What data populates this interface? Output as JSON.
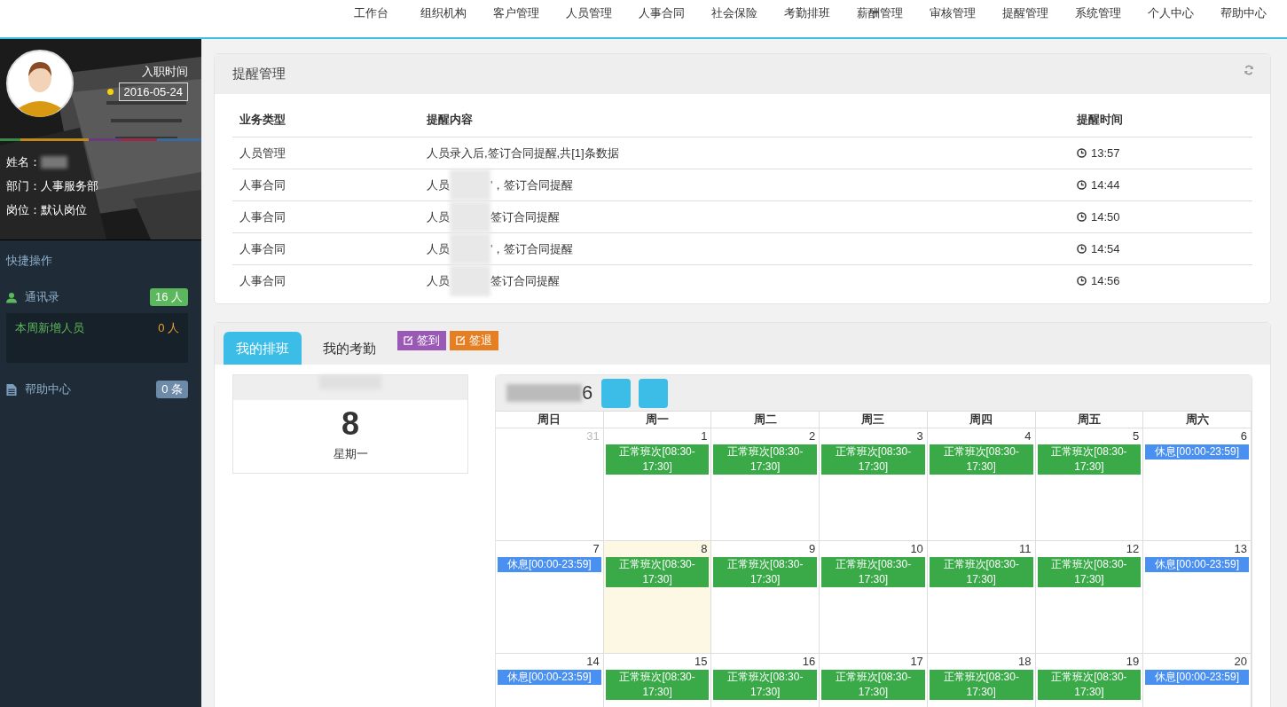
{
  "nav": [
    "工作台",
    "组织机构",
    "客户管理",
    "人员管理",
    "人事合同",
    "社会保险",
    "考勤排班",
    "薪酬管理",
    "审核管理",
    "提醒管理",
    "系统管理",
    "个人中心",
    "帮助中心"
  ],
  "profile": {
    "hire_label": "入职时间",
    "hire_date": "2016-05-24",
    "fields": [
      {
        "label": "姓名：",
        "value_redacted": true
      },
      {
        "label": "部门：人事服务部",
        "value_redacted": false
      },
      {
        "label": "岗位：默认岗位",
        "value_redacted": false
      }
    ]
  },
  "quick": {
    "title": "快捷操作",
    "contacts": {
      "label": "通讯录",
      "count": "16 人"
    },
    "new_staff": {
      "label": "本周新增人员",
      "count": "0 人"
    },
    "help": {
      "label": "帮助中心",
      "count": "0 条"
    }
  },
  "reminders": {
    "title": "提醒管理",
    "columns": [
      "业务类型",
      "提醒内容",
      "提醒时间"
    ],
    "rows": [
      {
        "type": "人员管理",
        "content_start": "人员录入后,签订合同提醒,共[1]条数据",
        "redacted": false,
        "content_end": "",
        "time": "13:57"
      },
      {
        "type": "人事合同",
        "content_start": "人员",
        "redacted": true,
        "content_end": "'，签订合同提醒",
        "time": "14:44"
      },
      {
        "type": "人事合同",
        "content_start": "人员",
        "redacted": true,
        "content_end": "签订合同提醒",
        "time": "14:50"
      },
      {
        "type": "人事合同",
        "content_start": "人员",
        "redacted": true,
        "content_end": "'，签订合同提醒",
        "time": "14:54"
      },
      {
        "type": "人事合同",
        "content_start": "人员",
        "redacted": true,
        "content_end": "签订合同提醒",
        "time": "14:56"
      }
    ]
  },
  "schedule": {
    "tabs": [
      {
        "label": "我的排班",
        "selected": true
      },
      {
        "label": "我的考勤",
        "selected": false
      }
    ],
    "actions": [
      {
        "label": "签到",
        "color": "#9b59b6"
      },
      {
        "label": "签退",
        "color": "#e67e22"
      }
    ],
    "today": {
      "day": "8",
      "weekday": "星期一"
    },
    "calendar": {
      "title_tail": "6",
      "weekdays": [
        "周日",
        "周一",
        "周二",
        "周三",
        "周四",
        "周五",
        "周六"
      ],
      "weeks": [
        [
          {
            "day": "31",
            "other_month": true,
            "today": false
          },
          {
            "day": "1",
            "other_month": false,
            "today": false,
            "event": {
              "kind": "work",
              "label": "正常班次[08:30-17:30]"
            }
          },
          {
            "day": "2",
            "other_month": false,
            "today": false,
            "event": {
              "kind": "work",
              "label": "正常班次[08:30-17:30]"
            }
          },
          {
            "day": "3",
            "other_month": false,
            "today": false,
            "event": {
              "kind": "work",
              "label": "正常班次[08:30-17:30]"
            }
          },
          {
            "day": "4",
            "other_month": false,
            "today": false,
            "event": {
              "kind": "work",
              "label": "正常班次[08:30-17:30]"
            }
          },
          {
            "day": "5",
            "other_month": false,
            "today": false,
            "event": {
              "kind": "work",
              "label": "正常班次[08:30-17:30]"
            }
          },
          {
            "day": "6",
            "other_month": false,
            "today": false,
            "event": {
              "kind": "rest",
              "label": "休息[00:00-23:59]"
            }
          }
        ],
        [
          {
            "day": "7",
            "other_month": false,
            "today": false,
            "event": {
              "kind": "rest",
              "label": "休息[00:00-23:59]"
            }
          },
          {
            "day": "8",
            "other_month": false,
            "today": true,
            "event": {
              "kind": "work",
              "label": "正常班次[08:30-17:30]"
            }
          },
          {
            "day": "9",
            "other_month": false,
            "today": false,
            "event": {
              "kind": "work",
              "label": "正常班次[08:30-17:30]"
            }
          },
          {
            "day": "10",
            "other_month": false,
            "today": false,
            "event": {
              "kind": "work",
              "label": "正常班次[08:30-17:30]"
            }
          },
          {
            "day": "11",
            "other_month": false,
            "today": false,
            "event": {
              "kind": "work",
              "label": "正常班次[08:30-17:30]"
            }
          },
          {
            "day": "12",
            "other_month": false,
            "today": false,
            "event": {
              "kind": "work",
              "label": "正常班次[08:30-17:30]"
            }
          },
          {
            "day": "13",
            "other_month": false,
            "today": false,
            "event": {
              "kind": "rest",
              "label": "休息[00:00-23:59]"
            }
          }
        ],
        [
          {
            "day": "14",
            "other_month": false,
            "today": false,
            "event": {
              "kind": "rest",
              "label": "休息[00:00-23:59]"
            }
          },
          {
            "day": "15",
            "other_month": false,
            "today": false,
            "event": {
              "kind": "work",
              "label": "正常班次[08:30-17:30]"
            }
          },
          {
            "day": "16",
            "other_month": false,
            "today": false,
            "event": {
              "kind": "work",
              "label": "正常班次[08:30-17:30]"
            }
          },
          {
            "day": "17",
            "other_month": false,
            "today": false,
            "event": {
              "kind": "work",
              "label": "正常班次[08:30-17:30]"
            }
          },
          {
            "day": "18",
            "other_month": false,
            "today": false,
            "event": {
              "kind": "work",
              "label": "正常班次[08:30-17:30]"
            }
          },
          {
            "day": "19",
            "other_month": false,
            "today": false,
            "event": {
              "kind": "work",
              "label": "正常班次[08:30-17:30]"
            }
          },
          {
            "day": "20",
            "other_month": false,
            "today": false,
            "event": {
              "kind": "rest",
              "label": "休息[00:00-23:59]"
            }
          }
        ]
      ]
    }
  }
}
